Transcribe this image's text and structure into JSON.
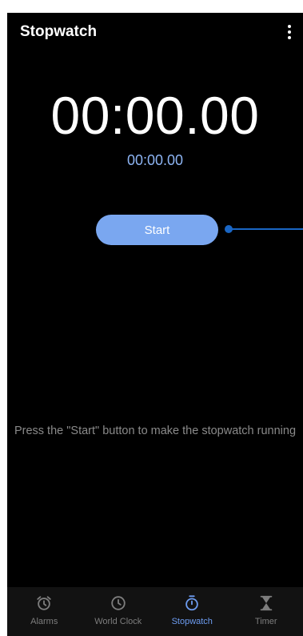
{
  "appbar": {
    "title": "Stopwatch",
    "overflow_icon": "more-vert-icon"
  },
  "stopwatch": {
    "main_time": "00:00.00",
    "lap_time": "00:00.00",
    "start_label": "Start",
    "hint": "Press the \"Start\" button to make the stopwatch running"
  },
  "colors": {
    "background": "#000000",
    "accent": "#7aa7f0",
    "lap_text": "#8db4f3",
    "pointer": "#1a66c4",
    "nav_active": "#6d9cf0",
    "nav_inactive": "#7d7d7d"
  },
  "bottom_nav": {
    "items": [
      {
        "label": "Alarms",
        "icon": "alarm-clock-icon",
        "active": false
      },
      {
        "label": "World Clock",
        "icon": "clock-icon",
        "active": false
      },
      {
        "label": "Stopwatch",
        "icon": "stopwatch-icon",
        "active": true
      },
      {
        "label": "Timer",
        "icon": "hourglass-icon",
        "active": false
      }
    ]
  }
}
